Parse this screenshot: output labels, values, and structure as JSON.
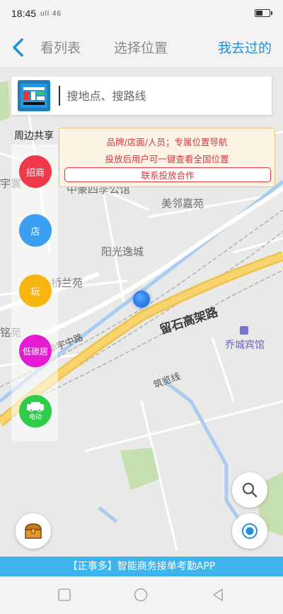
{
  "status_bar": {
    "time": "18:45",
    "signal": "ull 46"
  },
  "nav": {
    "list_label": "看列表",
    "select_label": "选择位置",
    "visited_label": "我去过的"
  },
  "search": {
    "placeholder": "搜地点、搜路线"
  },
  "side": {
    "title": "周边共享",
    "items": [
      {
        "label": "招商",
        "color": "#f0394a",
        "icon": ""
      },
      {
        "label": "店",
        "color": "#3a9ff0",
        "icon": ""
      },
      {
        "label": "玩",
        "color": "#f8b40f",
        "icon": ""
      },
      {
        "label": "低碳居",
        "color": "#e51ad3",
        "icon": ""
      },
      {
        "label": "电动",
        "color": "#2fcb4a",
        "icon": "car-icon"
      }
    ]
  },
  "promo": {
    "line1": "品牌/店面/人员；专属位置导航",
    "line2": "投放后用户可一键查看全国位置",
    "button": "联系投放合作"
  },
  "map_labels": {
    "poi1": "中豪四季公馆",
    "poi2": "美邻嘉苑",
    "poi3": "阳光逸城",
    "poi4": "桥兰苑",
    "poi5": "宇寰",
    "poi6": "铭苑",
    "road1": "留石高架路",
    "road2": "华宇中路",
    "road3": "筑览线",
    "hotel": "乔城宾馆"
  },
  "banner": {
    "text": "【正事多】智能商务接单考勤APP"
  },
  "colors": {
    "accent": "#1f8fe0",
    "banner": "#3db4ec",
    "promo_red": "#d9363e"
  }
}
